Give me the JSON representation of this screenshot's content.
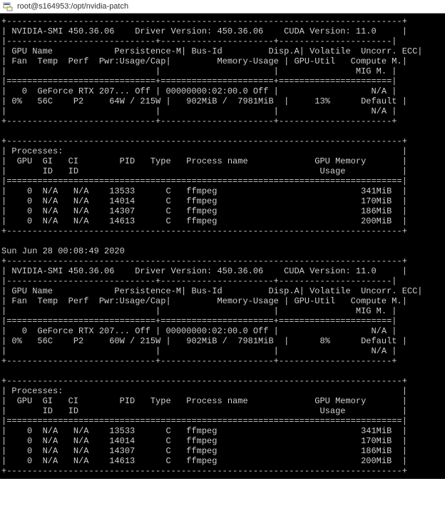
{
  "window": {
    "title": "root@s164953:/opt/nvidia-patch"
  },
  "runs": [
    {
      "header": {
        "smi_version": "450.36.06",
        "driver_version": "450.36.06",
        "cuda_version": "11.0"
      },
      "gpu": {
        "index": "0",
        "name": "GeForce RTX 207...",
        "persistence": "Off",
        "bus_id": "00000000:02:00.0",
        "disp_a": "Off",
        "fan": "0%",
        "temp": "56C",
        "perf": "P2",
        "pwr_usage": "64W",
        "pwr_cap": "215W",
        "mem_used": "902MiB",
        "mem_total": "7981MiB",
        "gpu_util": "13%",
        "ecc": "N/A",
        "compute_mode": "Default",
        "mig_mode": "N/A"
      },
      "processes": [
        {
          "gpu": "0",
          "gi": "N/A",
          "ci": "N/A",
          "pid": "13533",
          "type": "C",
          "name": "ffmpeg",
          "mem": "341MiB"
        },
        {
          "gpu": "0",
          "gi": "N/A",
          "ci": "N/A",
          "pid": "14014",
          "type": "C",
          "name": "ffmpeg",
          "mem": "170MiB"
        },
        {
          "gpu": "0",
          "gi": "N/A",
          "ci": "N/A",
          "pid": "14307",
          "type": "C",
          "name": "ffmpeg",
          "mem": "186MiB"
        },
        {
          "gpu": "0",
          "gi": "N/A",
          "ci": "N/A",
          "pid": "14613",
          "type": "C",
          "name": "ffmpeg",
          "mem": "200MiB"
        }
      ]
    },
    {
      "timestamp": "Sun Jun 28 00:08:49 2020",
      "header": {
        "smi_version": "450.36.06",
        "driver_version": "450.36.06",
        "cuda_version": "11.0"
      },
      "gpu": {
        "index": "0",
        "name": "GeForce RTX 207...",
        "persistence": "Off",
        "bus_id": "00000000:02:00.0",
        "disp_a": "Off",
        "fan": "0%",
        "temp": "56C",
        "perf": "P2",
        "pwr_usage": "60W",
        "pwr_cap": "215W",
        "mem_used": "902MiB",
        "mem_total": "7981MiB",
        "gpu_util": "8%",
        "ecc": "N/A",
        "compute_mode": "Default",
        "mig_mode": "N/A"
      },
      "processes": [
        {
          "gpu": "0",
          "gi": "N/A",
          "ci": "N/A",
          "pid": "13533",
          "type": "C",
          "name": "ffmpeg",
          "mem": "341MiB"
        },
        {
          "gpu": "0",
          "gi": "N/A",
          "ci": "N/A",
          "pid": "14014",
          "type": "C",
          "name": "ffmpeg",
          "mem": "170MiB"
        },
        {
          "gpu": "0",
          "gi": "N/A",
          "ci": "N/A",
          "pid": "14307",
          "type": "C",
          "name": "ffmpeg",
          "mem": "186MiB"
        },
        {
          "gpu": "0",
          "gi": "N/A",
          "ci": "N/A",
          "pid": "14613",
          "type": "C",
          "name": "ffmpeg",
          "mem": "200MiB"
        }
      ]
    }
  ],
  "labels": {
    "gpu": "GPU",
    "name": "Name",
    "persistence": "Persistence-M",
    "bus_id": "Bus-Id",
    "disp_a": "Disp.A",
    "volatile": "Volatile",
    "ecc": "Uncorr. ECC",
    "fan": "Fan",
    "temp": "Temp",
    "perf": "Perf",
    "pwr": "Pwr:Usage/Cap",
    "memusage": "Memory-Usage",
    "gpu_util": "GPU-Util",
    "compute": "Compute M.",
    "mig": "MIG M.",
    "processes": "Processes:",
    "gi": "GI",
    "ci": "CI",
    "id": "ID",
    "pid": "PID",
    "type": "Type",
    "pname": "Process name",
    "gpu_mem": "GPU Memory",
    "usage": "Usage"
  }
}
